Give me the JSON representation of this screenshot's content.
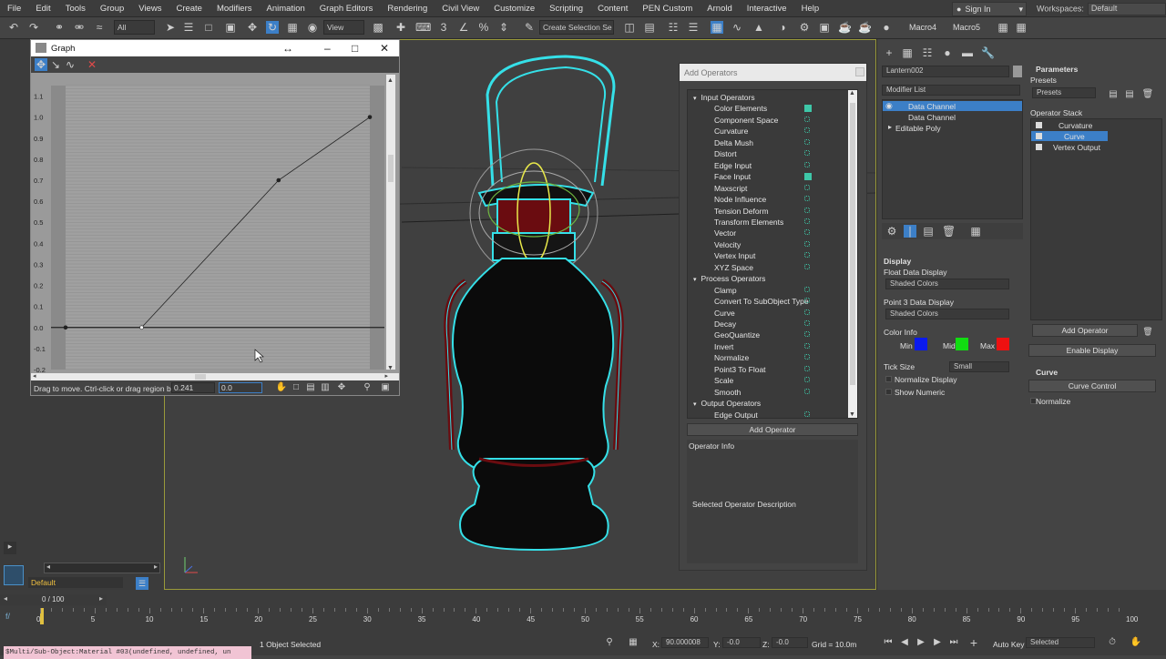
{
  "menu": [
    "File",
    "Edit",
    "Tools",
    "Group",
    "Views",
    "Create",
    "Modifiers",
    "Animation",
    "Graph Editors",
    "Rendering",
    "Civil View",
    "Customize",
    "Scripting",
    "Content",
    "PEN Custom",
    "Arnold",
    "Interactive",
    "Help"
  ],
  "account": {
    "signin": "Sign In"
  },
  "workspaces": {
    "label": "Workspaces:",
    "value": "Default"
  },
  "toolbar": {
    "filter_value": "All",
    "view_value": "View",
    "selection_set": "Create Selection Se",
    "macro4": "Macro4",
    "macro5": "Macro5"
  },
  "graph": {
    "title": "Graph",
    "y_ticks": [
      "1.1",
      "1.0",
      "0.9",
      "0.8",
      "0.7",
      "0.6",
      "0.5",
      "0.4",
      "0.3",
      "0.2",
      "0.1",
      "0.0",
      "-0.1",
      "-0.2"
    ],
    "status_message": "Drag to move. Ctrl-click or drag region box to",
    "x_value": "0.241",
    "y_value": "0.0"
  },
  "chart_data": {
    "type": "line",
    "x": [
      0.0,
      0.25,
      0.7,
      1.0
    ],
    "y": [
      0.0,
      0.0,
      0.7,
      1.0
    ],
    "ylim": [
      -0.2,
      1.15
    ],
    "xlim": [
      0.0,
      1.0
    ]
  },
  "add_operators": {
    "title": "Add Operators",
    "categories": [
      {
        "name": "Input Operators",
        "items": [
          "Color Elements",
          "Component Space",
          "Curvature",
          "Delta Mush",
          "Distort",
          "Edge Input",
          "Face Input",
          "Maxscript",
          "Node Influence",
          "Tension Deform",
          "Transform Elements",
          "Vector",
          "Velocity",
          "Vertex Input",
          "XYZ Space"
        ]
      },
      {
        "name": "Process Operators",
        "items": [
          "Clamp",
          "Convert To SubObject Type",
          "Curve",
          "Decay",
          "GeoQuantize",
          "Invert",
          "Normalize",
          "Point3 To Float",
          "Scale",
          "Smooth"
        ]
      },
      {
        "name": "Output Operators",
        "items": [
          "Edge Output"
        ]
      }
    ],
    "add_button": "Add Operator",
    "info_label": "Operator Info",
    "description": "Selected Operator Description"
  },
  "modify_panel": {
    "object_name": "Lantern002",
    "modifier_list": "Modifier List",
    "stack": [
      "Data Channel",
      "Data Channel",
      "Editable Poly"
    ],
    "display_title": "Display",
    "float_display_label": "Float Data Display",
    "float_display_value": "Shaded Colors",
    "point3_display_label": "Point 3 Data Display",
    "point3_display_value": "Shaded Colors",
    "color_info_label": "Color Info",
    "min_label": "Min",
    "mid_label": "Mid",
    "max_label": "Max",
    "min_color": "#0a1aee",
    "mid_color": "#11dd11",
    "max_color": "#ee1111",
    "tick_size_label": "Tick Size",
    "tick_size_value": "Small",
    "normalize_display": "Normalize Display",
    "show_numeric": "Show Numeric"
  },
  "parameters": {
    "title": "Parameters",
    "presets_label": "Presets",
    "presets_value": "Presets",
    "operator_stack_label": "Operator Stack",
    "operators": [
      "Curvature",
      "Curve",
      "Vertex Output"
    ],
    "add_operator": "Add Operator",
    "enable_display": "Enable Display",
    "curve_title": "Curve",
    "curve_control": "Curve Control",
    "normalize": "Normalize"
  },
  "bottom": {
    "layer": "Default",
    "frame_counter": "0 / 100",
    "timeline_ticks": [
      "0",
      "5",
      "10",
      "15",
      "20",
      "25",
      "30",
      "35",
      "40",
      "45",
      "50",
      "55",
      "60",
      "65",
      "70",
      "75",
      "80",
      "85",
      "90",
      "95",
      "100"
    ],
    "script_text": "$Multi/Sub-Object:Material #03(undefined, undefined, un",
    "selection_status": "1 Object Selected",
    "x_label": "X:",
    "x_value": "90.000008",
    "y_label": "Y:",
    "y_value": "-0.0",
    "z_label": "Z:",
    "z_value": "-0.0",
    "grid": "Grid = 10.0m",
    "autokey": "Auto Key",
    "selected": "Selected"
  },
  "colors": {
    "accent": "#3c7fc7",
    "viewport_border": "#9a9a3a",
    "wire": "#35e0e8"
  }
}
